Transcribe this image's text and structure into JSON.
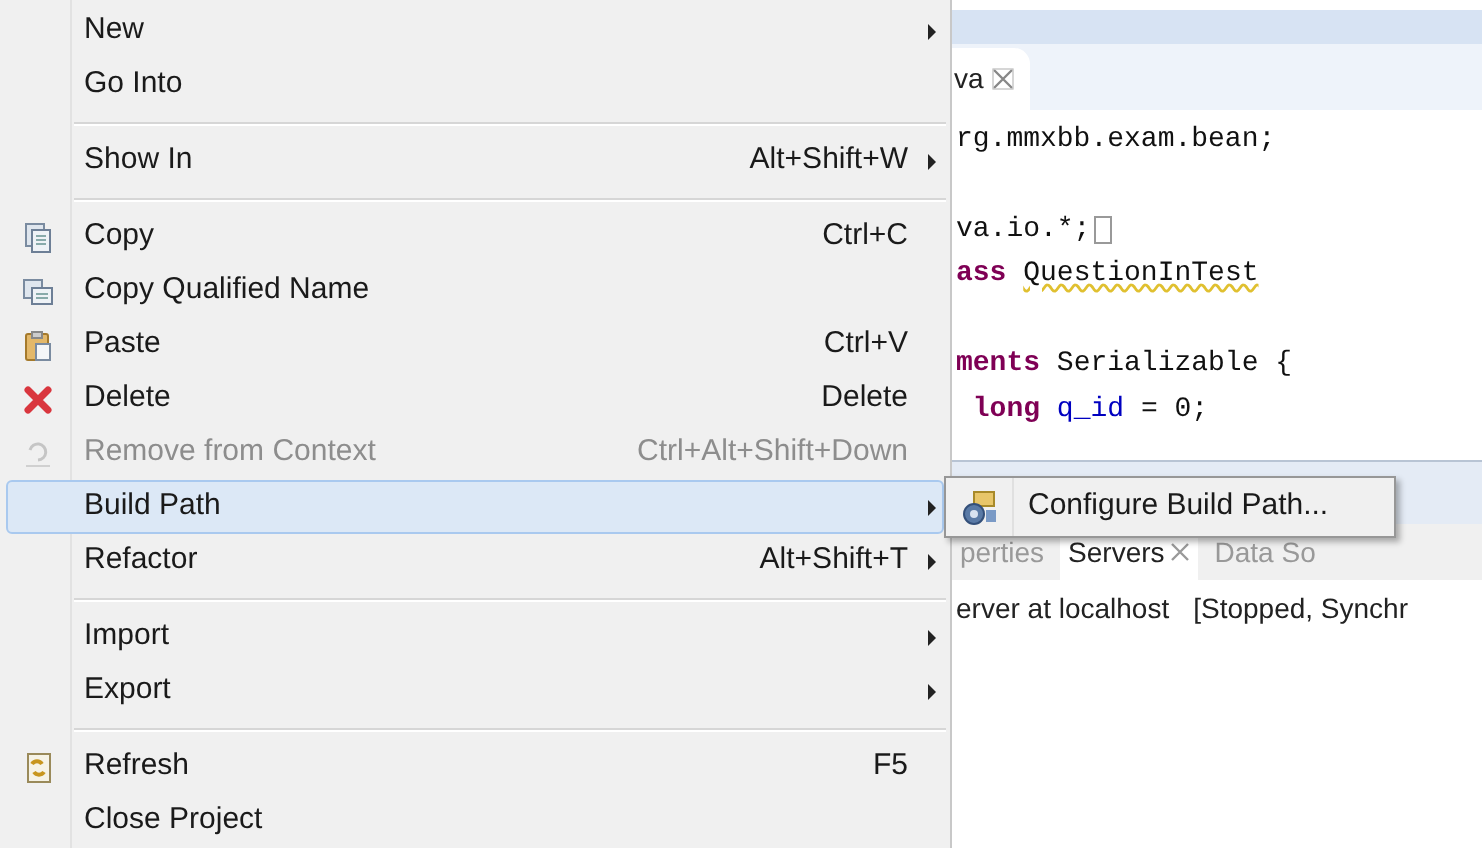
{
  "context_menu": {
    "items": [
      {
        "kind": "item",
        "label": "New",
        "submenu": true,
        "disabled": false,
        "selected": false
      },
      {
        "kind": "item",
        "label": "Go Into",
        "submenu": false,
        "disabled": false,
        "selected": false
      },
      {
        "kind": "separator"
      },
      {
        "kind": "item",
        "label": "Show In",
        "shortcut": "Alt+Shift+W",
        "submenu": true,
        "disabled": false,
        "selected": false
      },
      {
        "kind": "separator"
      },
      {
        "kind": "item",
        "label": "Copy",
        "shortcut": "Ctrl+C",
        "submenu": false,
        "disabled": false,
        "selected": false
      },
      {
        "kind": "item",
        "label": "Copy Qualified Name",
        "submenu": false,
        "disabled": false,
        "selected": false
      },
      {
        "kind": "item",
        "label": "Paste",
        "shortcut": "Ctrl+V",
        "submenu": false,
        "disabled": false,
        "selected": false
      },
      {
        "kind": "item",
        "label": "Delete",
        "shortcut": "Delete",
        "submenu": false,
        "disabled": false,
        "selected": false
      },
      {
        "kind": "item",
        "label": "Remove from Context",
        "shortcut": "Ctrl+Alt+Shift+Down",
        "submenu": false,
        "disabled": true,
        "selected": false
      },
      {
        "kind": "item",
        "label": "Build Path",
        "submenu": true,
        "disabled": false,
        "selected": true
      },
      {
        "kind": "item",
        "label": "Refactor",
        "shortcut": "Alt+Shift+T",
        "submenu": true,
        "disabled": false,
        "selected": false
      },
      {
        "kind": "separator"
      },
      {
        "kind": "item",
        "label": "Import",
        "submenu": true,
        "disabled": false,
        "selected": false
      },
      {
        "kind": "item",
        "label": "Export",
        "submenu": true,
        "disabled": false,
        "selected": false
      },
      {
        "kind": "separator"
      },
      {
        "kind": "item",
        "label": "Refresh",
        "shortcut": "F5",
        "submenu": false,
        "disabled": false,
        "selected": false
      },
      {
        "kind": "item",
        "label": "Close Project",
        "submenu": false,
        "disabled": false,
        "selected": false
      }
    ]
  },
  "submenu": {
    "items": [
      {
        "label": "Configure Build Path..."
      }
    ]
  },
  "editor": {
    "tab": {
      "label": "va"
    },
    "lines": [
      {
        "kind": "code",
        "tokens": [
          {
            "kind": "plain",
            "text": "rg.mmxbb.exam.bean;"
          }
        ]
      },
      {
        "kind": "blank"
      },
      {
        "kind": "code",
        "tokens": [
          {
            "kind": "plain",
            "text": "va.io.*;"
          }
        ],
        "folded": true
      },
      {
        "kind": "code",
        "tokens": [
          {
            "kind": "keyword",
            "text": "ass"
          },
          {
            "kind": "warning",
            "text": " QuestionInTest"
          }
        ]
      },
      {
        "kind": "blank"
      },
      {
        "kind": "code",
        "tokens": [
          {
            "kind": "keyword",
            "text": "ments"
          },
          {
            "kind": "plain",
            "text": " Serializable {"
          }
        ]
      },
      {
        "kind": "code",
        "tokens": [
          {
            "kind": "keyword",
            "text": " long"
          },
          {
            "kind": "field",
            "text": " q_id"
          },
          {
            "kind": "plain",
            "text": " = 0;"
          }
        ]
      }
    ]
  },
  "bottom_panel": {
    "tabs": [
      {
        "label": "perties",
        "selected": false
      },
      {
        "label": "Servers",
        "selected": true
      },
      {
        "label": "Data So",
        "selected": false
      }
    ],
    "server": {
      "name": "erver at localhost",
      "state": "[Stopped, Synchr"
    }
  }
}
